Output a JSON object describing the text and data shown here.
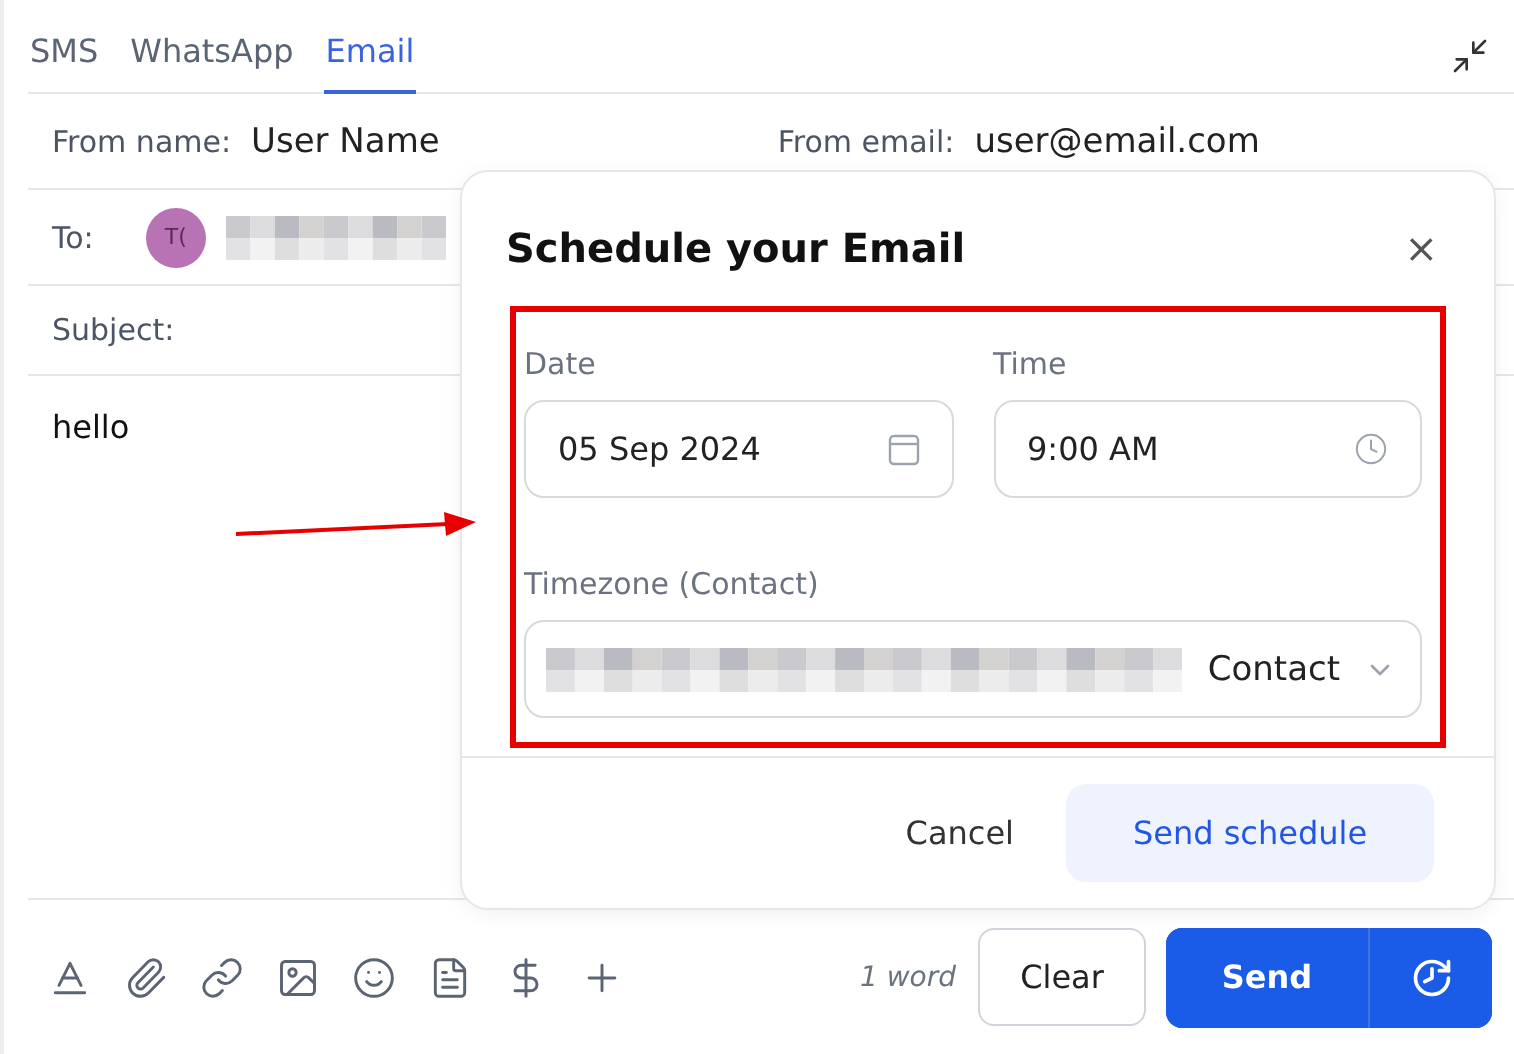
{
  "tabs": [
    {
      "label": "SMS",
      "selected": false
    },
    {
      "label": "WhatsApp",
      "selected": false
    },
    {
      "label": "Email",
      "selected": true
    }
  ],
  "header": {
    "from_name_label": "From name:",
    "from_name": "User Name",
    "from_email_label": "From email:",
    "from_email": "user@email.com",
    "to_label": "To:",
    "to_avatar": "T(",
    "subject_label": "Subject:"
  },
  "body": "hello",
  "toolbar": {
    "word_count": "1 word",
    "clear": "Clear",
    "send": "Send"
  },
  "dialog": {
    "title": "Schedule your Email",
    "close": "×",
    "date_label": "Date",
    "date": "05 Sep 2024",
    "time_label": "Time",
    "time": "9:00 AM",
    "timezone_label": "Timezone (Contact)",
    "timezone_suffix": "Contact",
    "cancel": "Cancel",
    "confirm": "Send schedule"
  }
}
